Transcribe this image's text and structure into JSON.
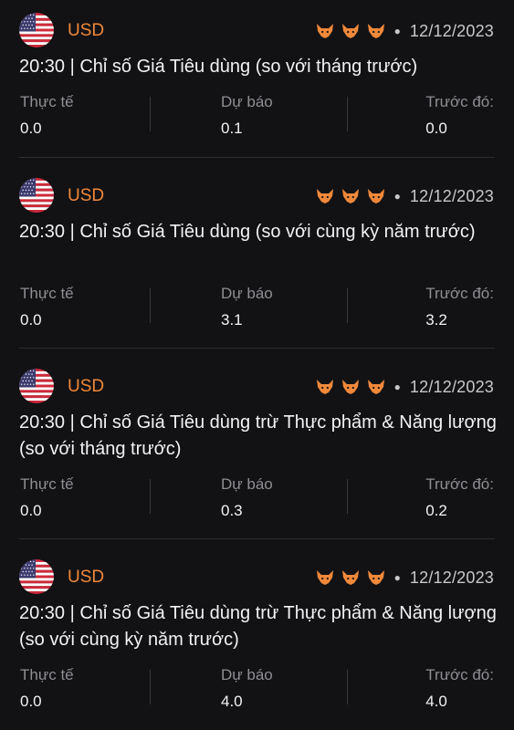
{
  "colors": {
    "background": "#121214",
    "accent": "#f0883a",
    "text_primary": "#f2f2f4",
    "text_secondary": "#8e8e93"
  },
  "events": [
    {
      "flag_icon": "us-flag-icon",
      "currency": "USD",
      "impact_level": 3,
      "impact_icon": "bull-icon",
      "date": "12/12/2023",
      "title": "20:30 | Chỉ số Giá Tiêu dùng (so với tháng trước)",
      "actual_label": "Thực tế",
      "actual_value": "0.0",
      "forecast_label": "Dự báo",
      "forecast_value": "0.1",
      "previous_label": "Trước đó:",
      "previous_value": "0.0"
    },
    {
      "flag_icon": "us-flag-icon",
      "currency": "USD",
      "impact_level": 3,
      "impact_icon": "bull-icon",
      "date": "12/12/2023",
      "title": "20:30 | Chỉ số Giá Tiêu dùng (so với cùng kỳ năm trước)",
      "actual_label": "Thực tế",
      "actual_value": "0.0",
      "forecast_label": "Dự báo",
      "forecast_value": "3.1",
      "previous_label": "Trước đó:",
      "previous_value": "3.2"
    },
    {
      "flag_icon": "us-flag-icon",
      "currency": "USD",
      "impact_level": 3,
      "impact_icon": "bull-icon",
      "date": "12/12/2023",
      "title": "20:30 | Chỉ số Giá Tiêu dùng trừ Thực phẩm & Năng lượng (so với tháng trước)",
      "actual_label": "Thực tế",
      "actual_value": "0.0",
      "forecast_label": "Dự báo",
      "forecast_value": "0.3",
      "previous_label": "Trước đó:",
      "previous_value": "0.2"
    },
    {
      "flag_icon": "us-flag-icon",
      "currency": "USD",
      "impact_level": 3,
      "impact_icon": "bull-icon",
      "date": "12/12/2023",
      "title": "20:30 | Chỉ số Giá Tiêu dùng trừ Thực phẩm & Năng lượng (so với cùng kỳ năm trước)",
      "actual_label": "Thực tế",
      "actual_value": "0.0",
      "forecast_label": "Dự báo",
      "forecast_value": "4.0",
      "previous_label": "Trước đó:",
      "previous_value": "4.0"
    }
  ]
}
